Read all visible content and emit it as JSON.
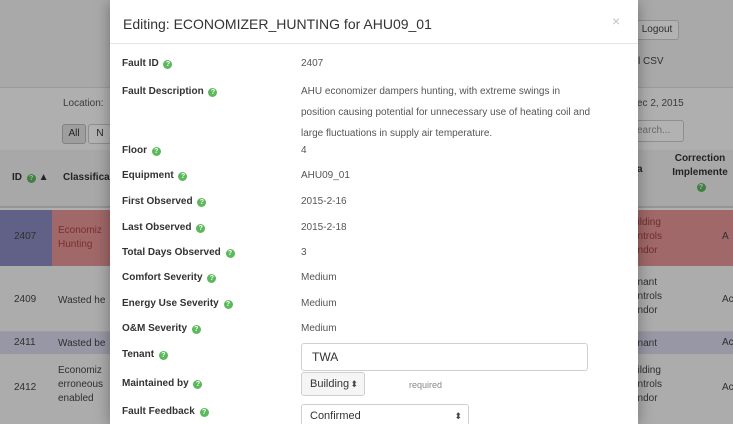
{
  "background": {
    "logout_label": "Logout",
    "csv_label": "l CSV",
    "location_label": "Location:",
    "date_label": "ec 2, 2015",
    "filter_all": "All",
    "filter_n": "N",
    "search_placeholder": "earch...",
    "table": {
      "col_id": "ID",
      "col_id_sort": "▲",
      "col_classification": "Classifica",
      "col_a": "a",
      "col_correction": "Correction",
      "col_implemented": "Implemente",
      "rows": [
        {
          "id": "2407",
          "classification": [
            "Economiz",
            "Hunting"
          ],
          "responsible": [
            "uilding",
            "ontrols",
            "endor"
          ],
          "action": "A"
        },
        {
          "id": "2409",
          "classification": [
            "Wasted he"
          ],
          "responsible": [
            "enant",
            "ontrols",
            "endor"
          ],
          "action": "Ac"
        },
        {
          "id": "2411",
          "classification": [
            "Wasted be"
          ],
          "responsible": [
            "enant"
          ],
          "action": "Ac"
        },
        {
          "id": "2412",
          "classification": [
            "Economiz",
            "erroneous",
            "enabled"
          ],
          "responsible": [
            "uilding",
            "ontrols",
            "endor"
          ],
          "action": "Ac"
        }
      ]
    }
  },
  "modal": {
    "title": "Editing: ECONOMIZER_HUNTING for AHU09_01",
    "close_label": "×",
    "help_glyph": "?",
    "fields": {
      "fault_id": {
        "label": "Fault ID",
        "value": "2407"
      },
      "fault_description": {
        "label": "Fault Description",
        "value": "AHU economizer dampers hunting, with extreme swings in position causing potential for unnecessary use of heating coil and large fluctuations in supply air temperature."
      },
      "floor": {
        "label": "Floor",
        "value": "4"
      },
      "equipment": {
        "label": "Equipment",
        "value": "AHU09_01"
      },
      "first_observed": {
        "label": "First Observed",
        "value": "2015-2-16"
      },
      "last_observed": {
        "label": "Last Observed",
        "value": "2015-2-18"
      },
      "total_days": {
        "label": "Total Days Observed",
        "value": "3"
      },
      "comfort_severity": {
        "label": "Comfort Severity",
        "value": "Medium"
      },
      "energy_severity": {
        "label": "Energy Use Severity",
        "value": "Medium"
      },
      "om_severity": {
        "label": "O&M Severity",
        "value": "Medium"
      },
      "tenant": {
        "label": "Tenant",
        "value": "TWA"
      },
      "maintained_by": {
        "label": "Maintained by",
        "value": "Building",
        "required_note": "required"
      },
      "fault_feedback": {
        "label": "Fault Feedback",
        "value": "Confirmed"
      }
    },
    "select_arrow": "⬍"
  },
  "colors": {
    "help_icon": "#5cb85c",
    "row_highlight": "#e59696",
    "row_id_highlight": "#8c8cc2",
    "row_selected": "#d8d8ec"
  }
}
